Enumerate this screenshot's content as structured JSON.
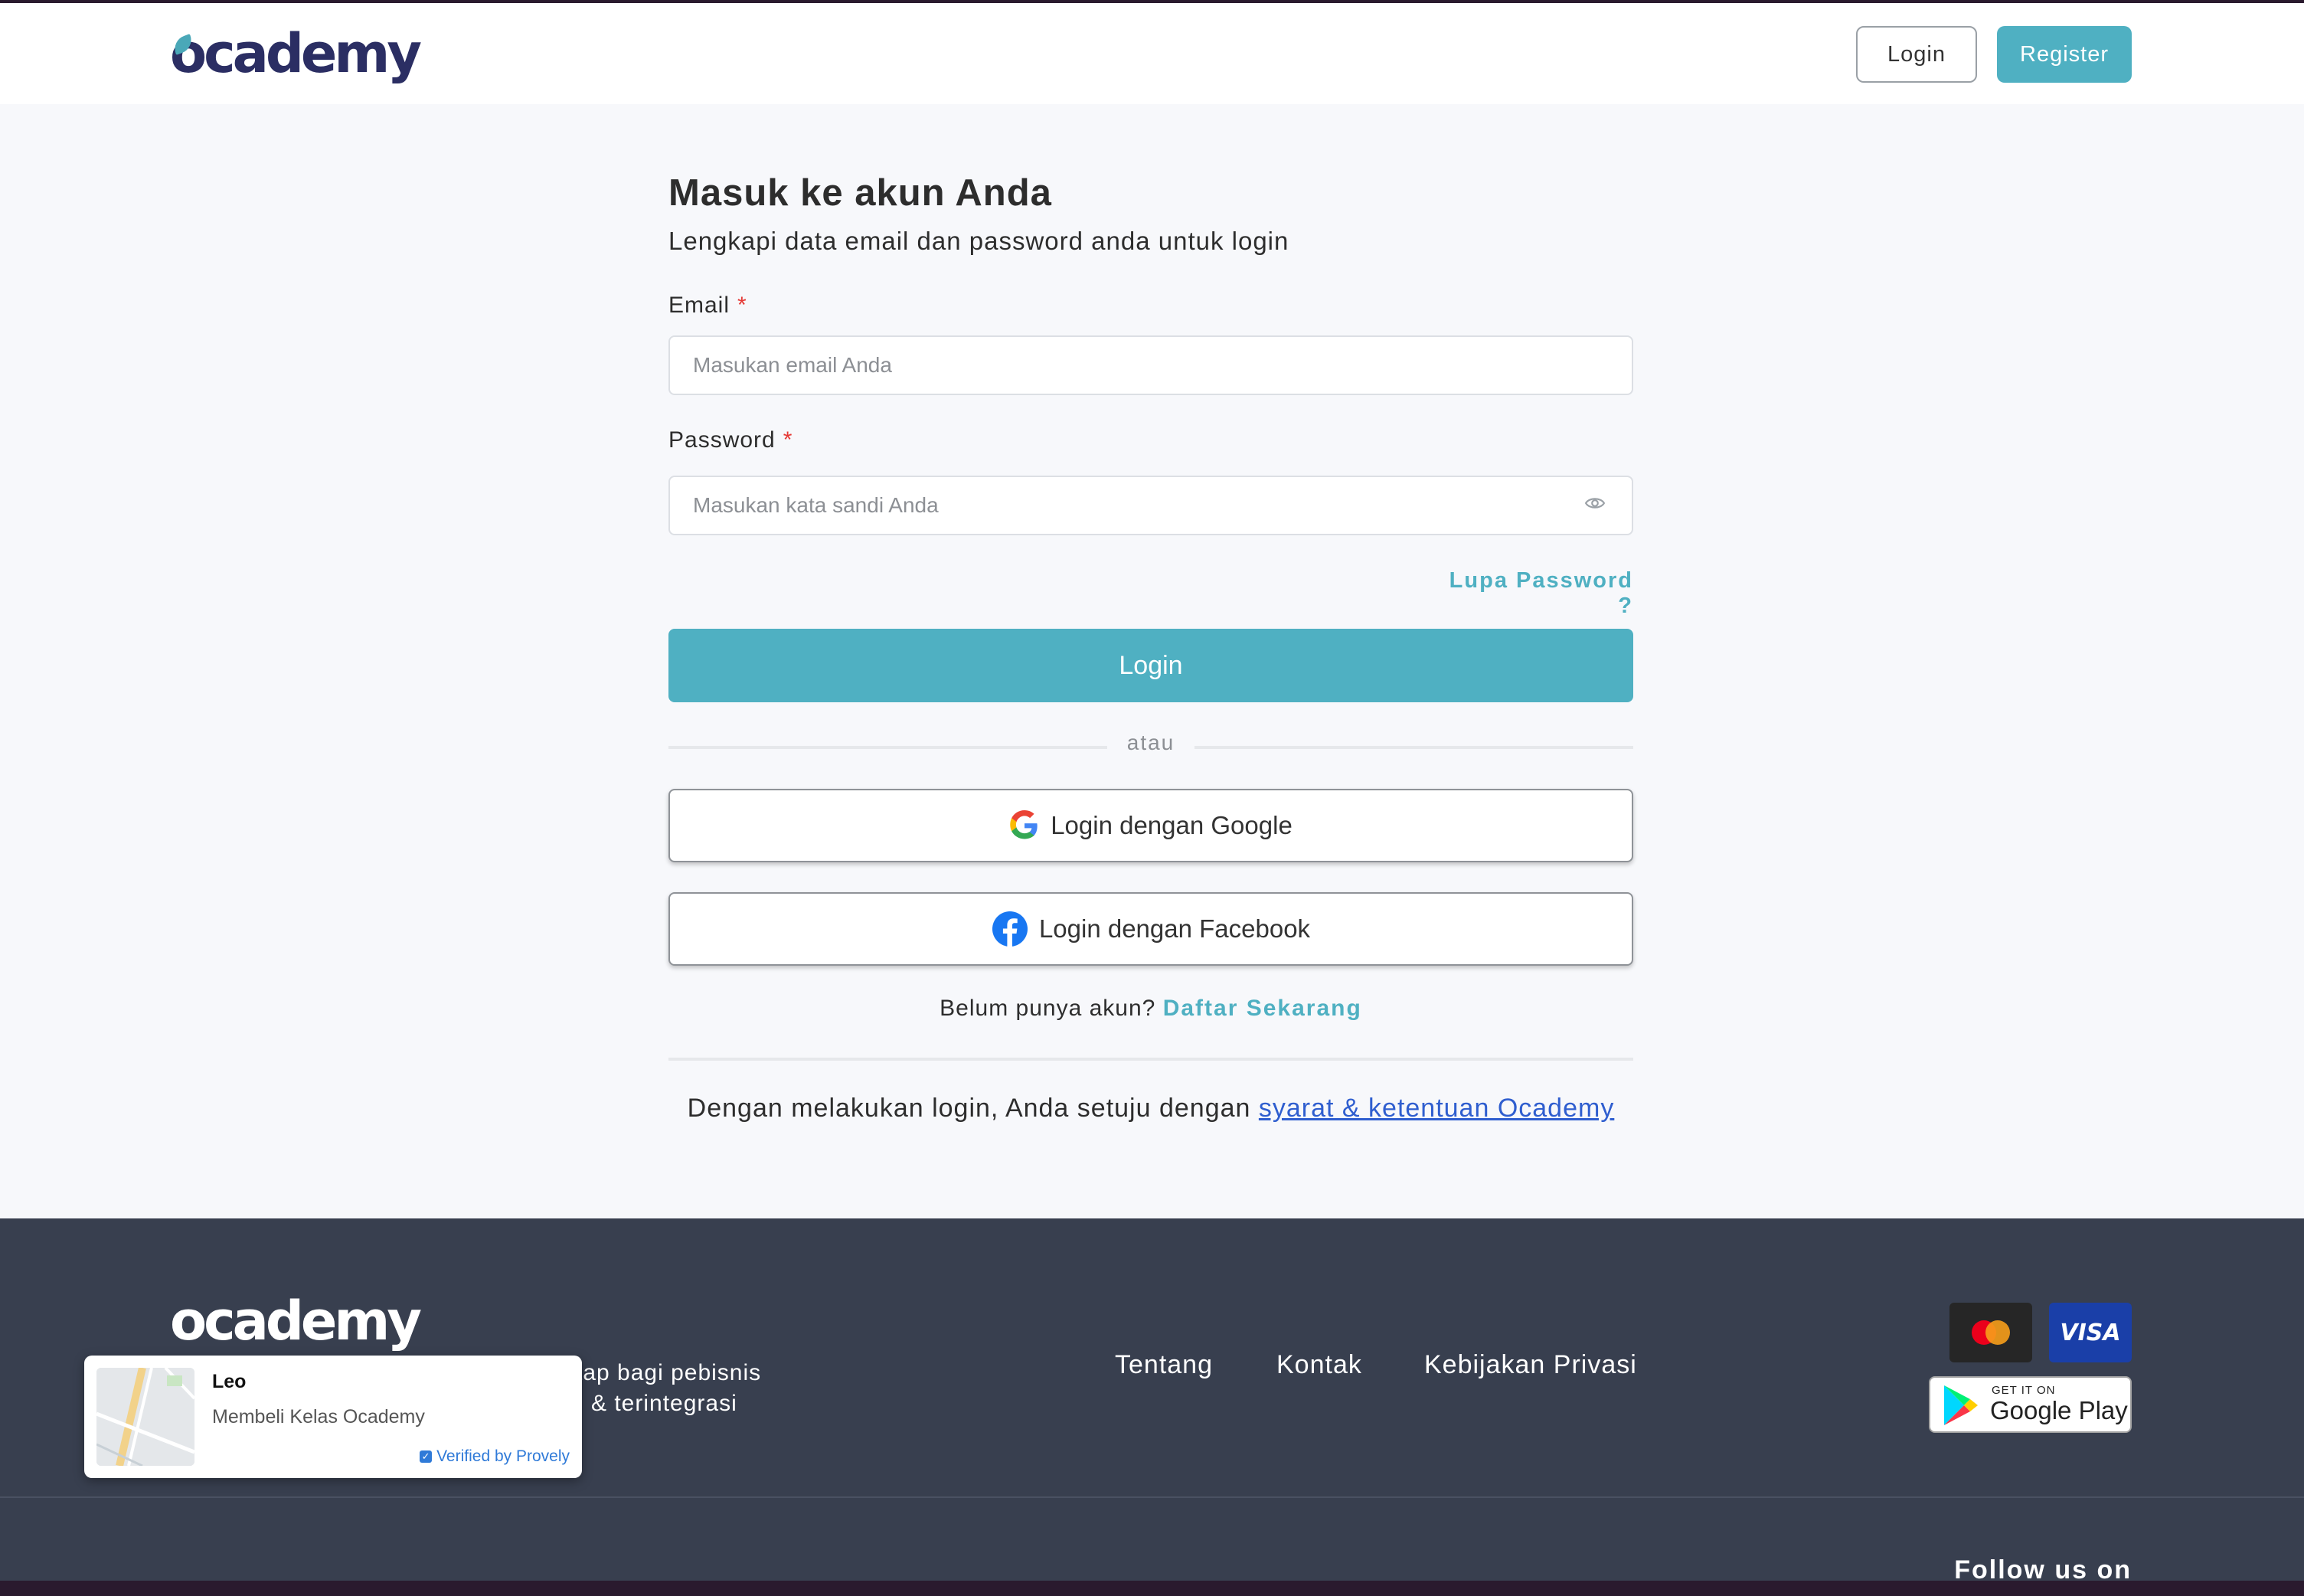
{
  "header": {
    "logo": "ocademy",
    "login_label": "Login",
    "register_label": "Register"
  },
  "form": {
    "title": "Masuk ke akun Anda",
    "subtitle": "Lengkapi data email dan password anda untuk login",
    "email_label": "Email",
    "email_placeholder": "Masukan email Anda",
    "password_label": "Password",
    "password_placeholder": "Masukan kata sandi Anda",
    "required_mark": "*",
    "forgot_label": "Lupa Password ?",
    "login_label": "Login",
    "divider_text": "atau",
    "google_label": "Login dengan Google",
    "facebook_label": "Login dengan Facebook",
    "signup_prompt": "Belum punya akun?",
    "signup_link": "Daftar Sekarang",
    "terms_prefix": "Dengan melakukan login, Anda setuju dengan",
    "terms_link": "syarat & ketentuan Ocademy"
  },
  "footer": {
    "logo": "ocademy",
    "tagline_line1": "tap bagi pebisnis",
    "tagline_line2": "& terintegrasi",
    "links": [
      "Tentang",
      "Kontak",
      "Kebijakan Privasi"
    ],
    "visa_label": "VISA",
    "gplay_small": "GET IT ON",
    "gplay_big": "Google Play",
    "follow_label": "Follow us on"
  },
  "notification": {
    "name": "Leo",
    "message": "Membeli Kelas Ocademy",
    "verified": "Verified by Provely"
  },
  "colors": {
    "accent": "#4fb0c2",
    "brand_navy": "#2b2e63",
    "footer_bg": "#383f4f",
    "required": "#e53935",
    "terms_link": "#2f5ecf"
  }
}
